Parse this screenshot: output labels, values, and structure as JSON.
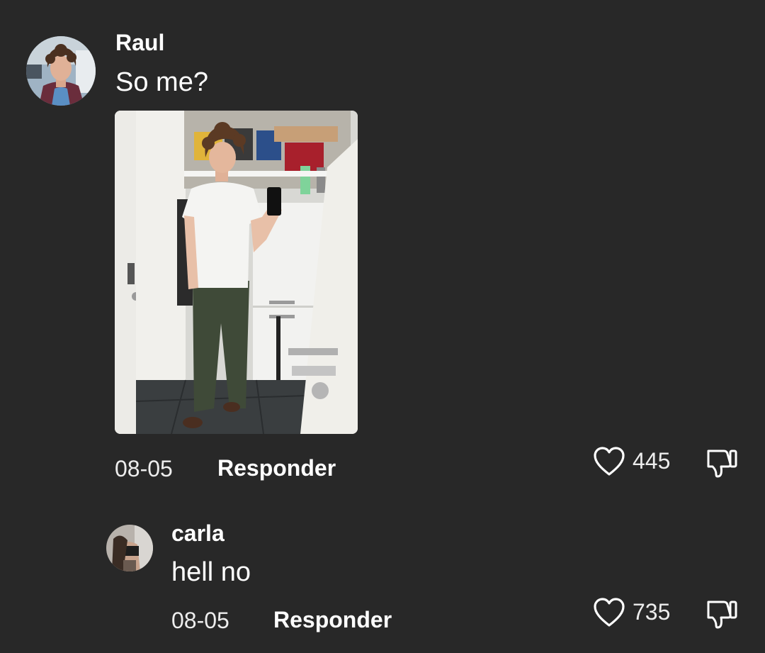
{
  "comments": [
    {
      "username": "Raul",
      "text": "So me?",
      "date": "08-05",
      "reply_label": "Responder",
      "likes": "445",
      "has_photo": true,
      "avatar_icon": "user-avatar-photo",
      "photo_icon": "mirror-selfie-photo"
    },
    {
      "username": "carla",
      "text": "hell no",
      "date": "08-05",
      "reply_label": "Responder",
      "likes": "735",
      "avatar_icon": "user-avatar-photo"
    }
  ],
  "icons": {
    "like": "heart-icon",
    "dislike": "thumbs-down-icon"
  },
  "colors": {
    "background": "#282828",
    "text": "#ffffff",
    "meta": "#ededed"
  }
}
